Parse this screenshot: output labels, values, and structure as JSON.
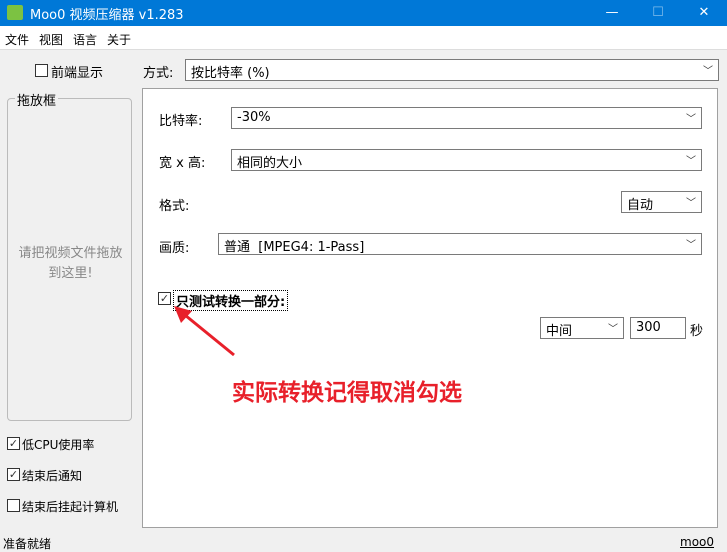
{
  "window": {
    "title": "Moo0 视频压缩器 v1.283",
    "minimize": "—",
    "maximize": "☐",
    "close": "✕"
  },
  "menu": [
    "文件",
    "视图",
    "语言",
    "关于"
  ],
  "left": {
    "front_display": "前端显示",
    "drop_box_title": "拖放框",
    "drop_hint": "请把视频文件拖放到这里!",
    "options": [
      {
        "label": "低CPU使用率",
        "checked": true
      },
      {
        "label": "结束后通知",
        "checked": true
      },
      {
        "label": "结束后挂起计算机",
        "checked": false
      }
    ]
  },
  "mode": {
    "label": "方式:",
    "value": "按比特率 (%)"
  },
  "settings": {
    "bitrate": {
      "label": "比特率:",
      "value": "-30%"
    },
    "size": {
      "label": "宽 x 高:",
      "value": "相同的大小"
    },
    "format": {
      "label": "格式:",
      "value": "自动"
    },
    "quality": {
      "label": "画质:",
      "value": "普通  [MPEG4: 1-Pass]"
    },
    "test": {
      "label": "只测试转换一部分:",
      "checked": true,
      "position": "中间",
      "seconds": "300",
      "unit": "秒"
    }
  },
  "annotation": "实际转换记得取消勾选",
  "status": {
    "text": "准备就绪",
    "link": "moo0"
  },
  "check": "✓"
}
